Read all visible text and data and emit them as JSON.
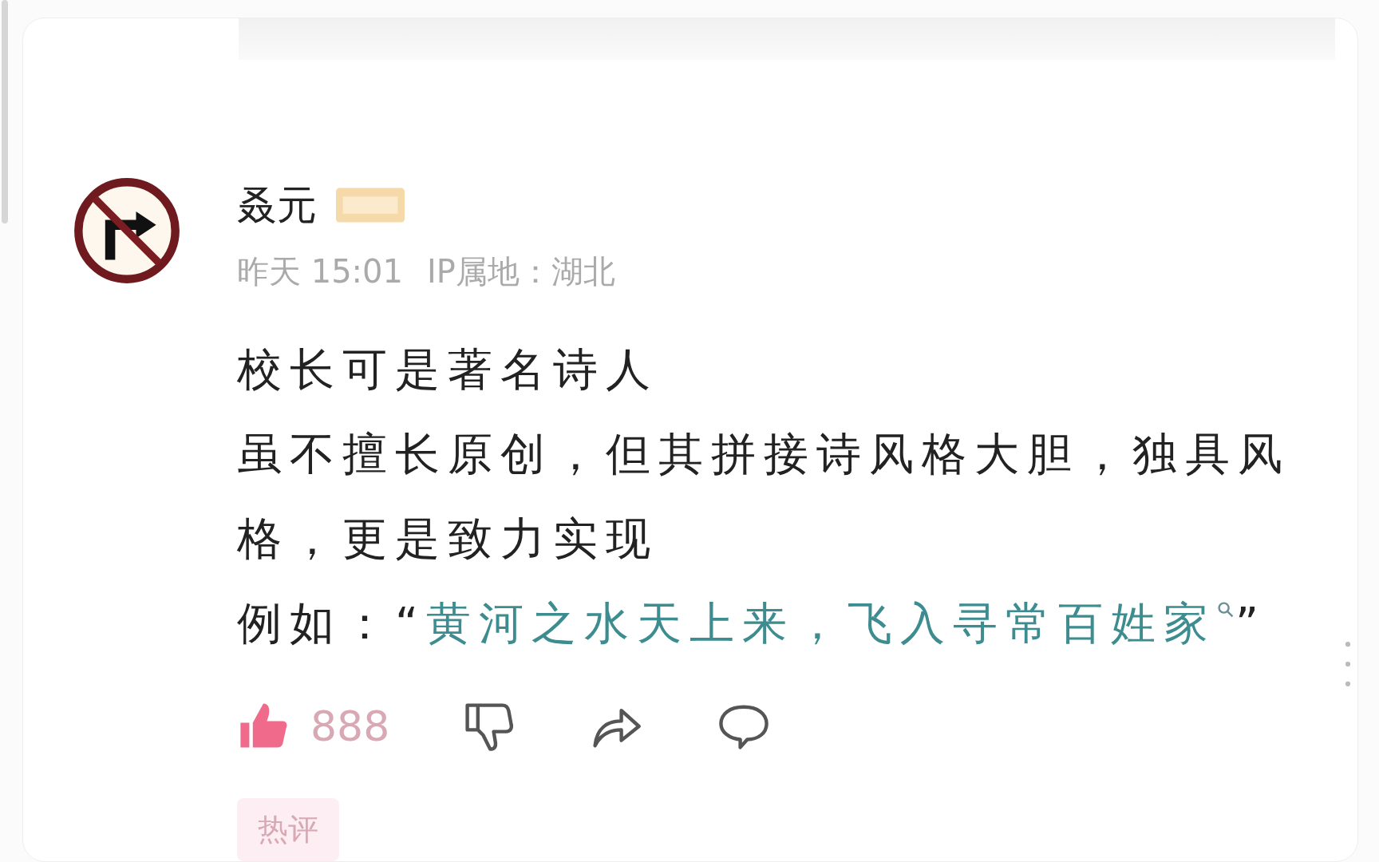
{
  "comment": {
    "author": "叒元",
    "time": "昨天 15:01",
    "ip_location": "IP属地：湖北",
    "paragraphs": [
      {
        "text": "校长可是著名诗人"
      },
      {
        "text": "虽不擅长原创，但其拼接诗风格大胆，独具风格，更是致力实现"
      },
      {
        "text": "例如：“",
        "link": "黄河之水天上来，飞入寻常百姓家",
        "after": "”"
      }
    ],
    "likes": "888",
    "liked": true,
    "tag": "热评"
  }
}
